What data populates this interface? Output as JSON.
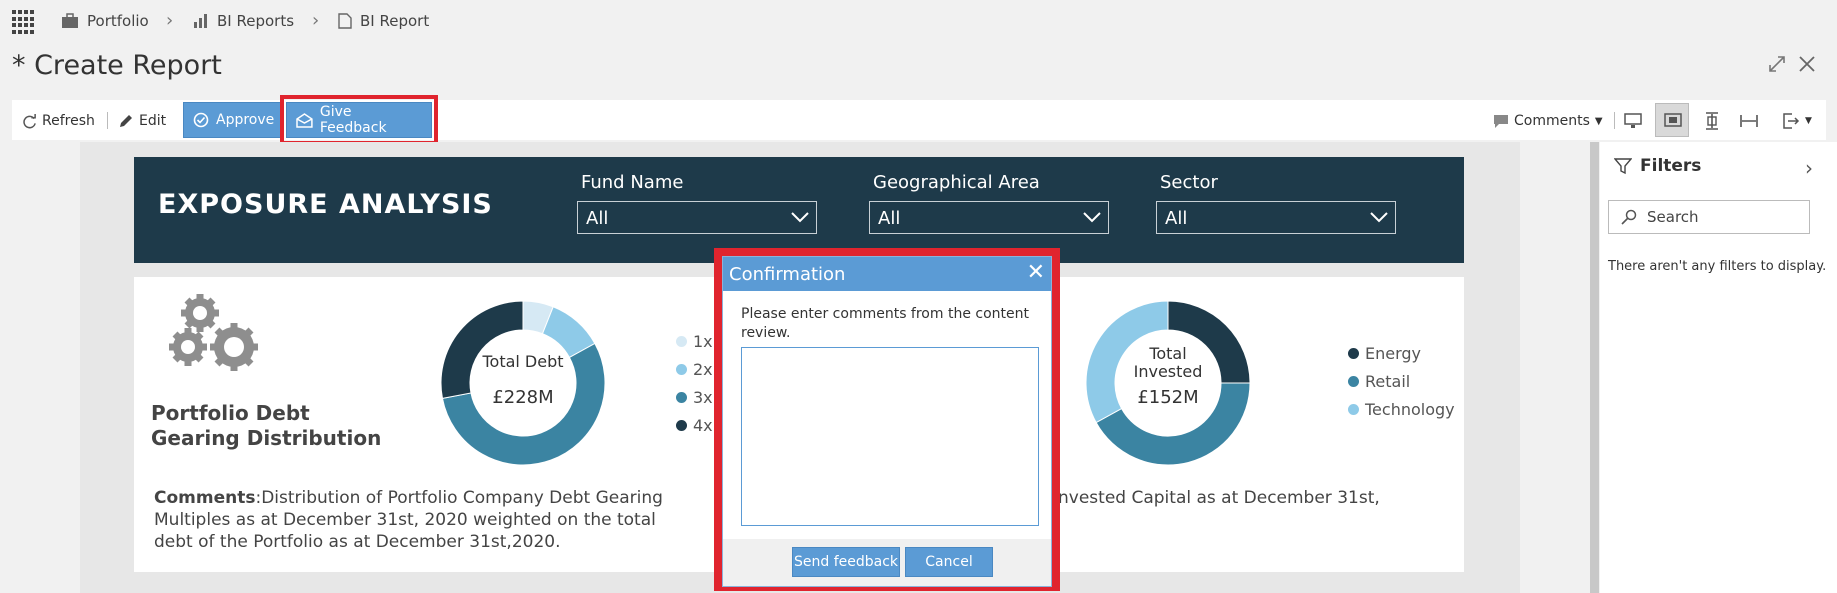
{
  "breadcrumb": {
    "items": [
      "Portfolio",
      "BI Reports",
      "BI Report"
    ]
  },
  "page": {
    "title": "* Create Report"
  },
  "toolbar": {
    "refresh": "Refresh",
    "edit": "Edit",
    "approve": "Approve",
    "give_feedback": "Give Feedback",
    "comments": "Comments"
  },
  "report": {
    "banner_title": "EXPOSURE ANALYSIS",
    "filters": [
      {
        "label": "Fund Name",
        "value": "All"
      },
      {
        "label": "Geographical Area",
        "value": "All"
      },
      {
        "label": "Sector",
        "value": "All"
      }
    ],
    "left": {
      "title_line1": "Portfolio Debt",
      "title_line2": "Gearing Distribution",
      "donut_label": "Total Debt",
      "donut_value": "£228M",
      "comments_label": "Comments",
      "comments_text_1": ":Distribution of Portfolio Company Debt Gearing",
      "comments_text_2": "Multiples as at December 31st, 2020 weighted on the total",
      "comments_text_3": "debt of the Portfolio as at December 31st,2020."
    },
    "right": {
      "donut_label_1": "Total",
      "donut_label_2": "Invested",
      "donut_value": "£152M",
      "comments_fragment": "nvested Capital as at December 31st,"
    }
  },
  "chart_data": [
    {
      "type": "pie",
      "categories": [
        "1x",
        "2x",
        "3x",
        "4x"
      ],
      "values": [
        6,
        11,
        55,
        28
      ],
      "colors": [
        "#d6e9f4",
        "#8ecae8",
        "#3b84a2",
        "#1e3a4a"
      ]
    },
    {
      "type": "pie",
      "categories": [
        "Energy",
        "Retail",
        "Technology"
      ],
      "values": [
        25,
        42,
        33
      ],
      "colors": [
        "#1e3a4a",
        "#3b84a2",
        "#8ecae8"
      ]
    }
  ],
  "filters_pane": {
    "title": "Filters",
    "search_placeholder": "Search",
    "empty_text": "There aren't any filters to display."
  },
  "dialog": {
    "title": "Confirmation",
    "message": "Please enter comments from the content review.",
    "comment_value": "",
    "send_label": "Send feedback",
    "cancel_label": "Cancel"
  }
}
